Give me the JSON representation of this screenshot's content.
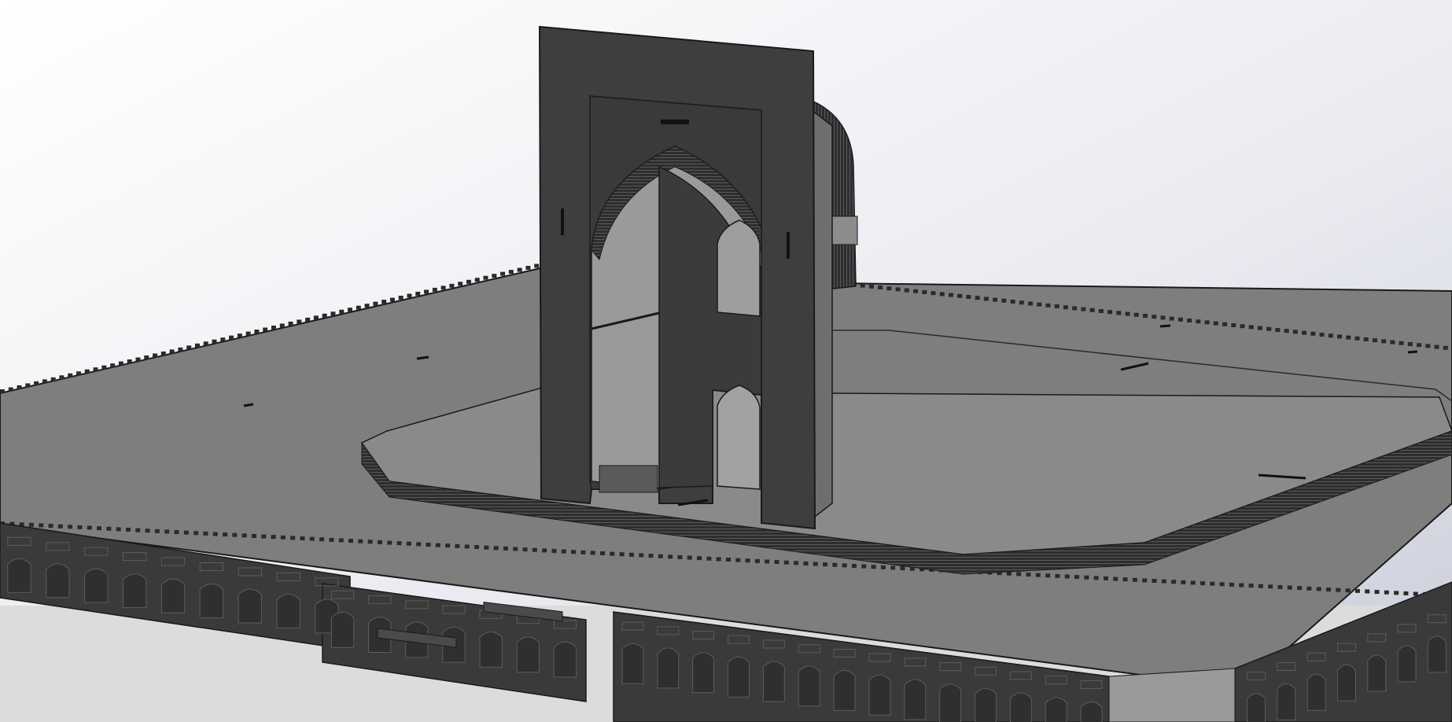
{
  "viewport": {
    "background_top": "#ffffff",
    "background_bottom": "#c8ccd8"
  },
  "model": {
    "platform": "platform",
    "octagonal_plinth": "octagonal-plinth",
    "portal": "iwan-portal",
    "crenellations": "crenellations",
    "arcade_walls": "arcade-walls"
  },
  "colors": {
    "deck": "#7e7e7e",
    "deck_shadow": "#6a6a6a",
    "dark_panel": "#3d3d3d",
    "edge": "#1a1a1a",
    "plinth": "#808080",
    "plinth_side": "#4a4a4a",
    "reflection": "#dcdcdc"
  }
}
